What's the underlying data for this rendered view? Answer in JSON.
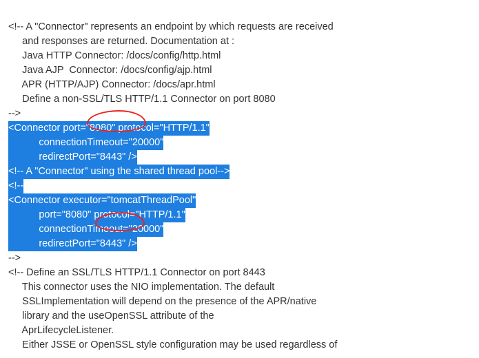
{
  "lines": {
    "c1a": "<!-- A \"Connector\" represents an endpoint by which requests are received",
    "c1b": "     and responses are returned. Documentation at :",
    "c1c": "     Java HTTP Connector: /docs/config/http.html",
    "c1d": "     Java AJP  Connector: /docs/config/ajp.html",
    "c1e": "     APR (HTTP/AJP) Connector: /docs/apr.html",
    "c1f": "     Define a non-SSL/TLS HTTP/1.1 Connector on port 8080",
    "c1g": "-->",
    "h1a": "<Connector port=\"8080\" protocol=\"HTTP/1.1\"",
    "h1b": "           connectionTimeout=\"20000\"",
    "h1c": "           redirectPort=\"8443\" />",
    "h2": "<!-- A \"Connector\" using the shared thread pool-->",
    "h3": "<!--",
    "h4a": "<Connector executor=\"tomcatThreadPool\"",
    "h4b": "           port=\"8080\" protocol=\"HTTP/1.1\"",
    "h4c": "           connectionTimeout=\"20000\"",
    "h4d": "           redirectPort=\"8443\" />",
    "c2a": "-->",
    "c3a": "<!-- Define an SSL/TLS HTTP/1.1 Connector on port 8443",
    "c3b": "     This connector uses the NIO implementation. The default",
    "c3c": "     SSLImplementation will depend on the presence of the APR/native",
    "c3d": "     library and the useOpenSSL attribute of the",
    "c3e": "     AprLifecycleListener.",
    "c3f": "     Either JSSE or OpenSSL style configuration may be used regardless of"
  },
  "highlight_color": "#1e7fe0",
  "annotation_color": "#e22"
}
